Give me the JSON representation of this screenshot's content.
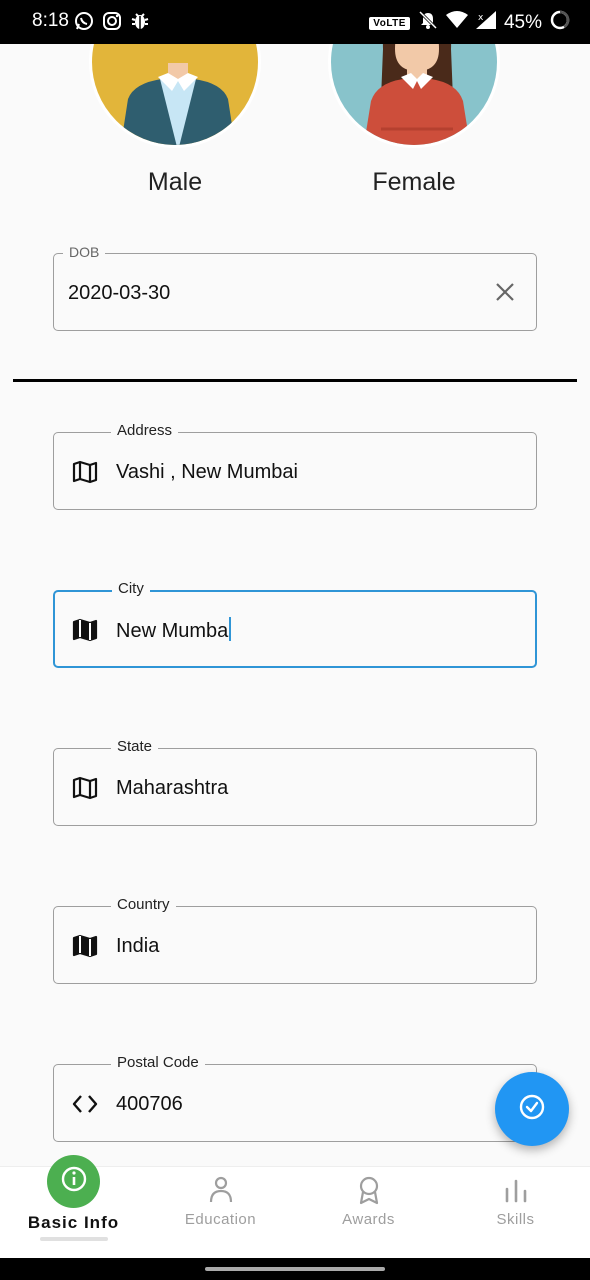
{
  "status_bar": {
    "time": "8:18",
    "volte": "VoLTE",
    "battery": "45%"
  },
  "gender": {
    "male_label": "Male",
    "female_label": "Female"
  },
  "dob": {
    "label": "DOB",
    "value": "2020-03-30"
  },
  "fields": {
    "address": {
      "label": "Address",
      "value": "Vashi , New Mumbai",
      "icon": "map-icon"
    },
    "city": {
      "label": "City",
      "value": "New Mumba",
      "icon": "map-icon"
    },
    "state": {
      "label": "State",
      "value": "Maharashtra",
      "icon": "map-icon"
    },
    "country": {
      "label": "Country",
      "value": "India",
      "icon": "map-icon"
    },
    "postal": {
      "label": "Postal Code",
      "value": "400706",
      "icon": "code-icon"
    }
  },
  "bottom_nav": {
    "basic_info": "Basic Info",
    "education": "Education",
    "awards": "Awards",
    "skills": "Skills"
  },
  "colors": {
    "focus": "#2f95d6",
    "fab": "#2196f3",
    "active_nav": "#4caf50"
  }
}
